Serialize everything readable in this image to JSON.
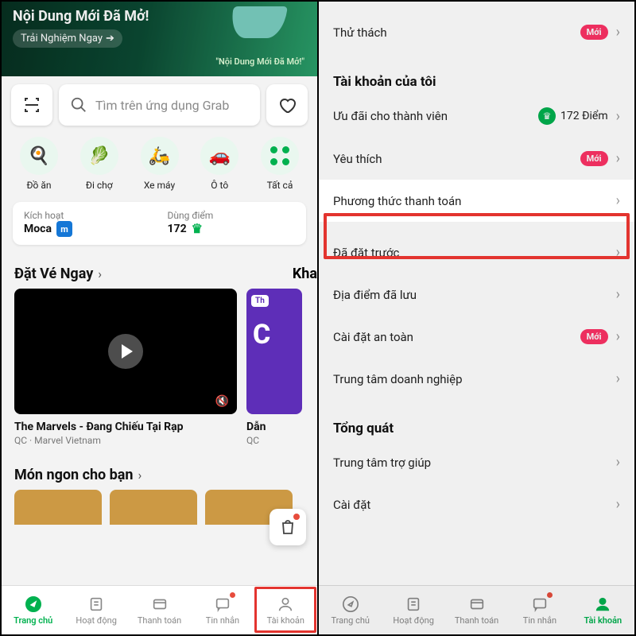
{
  "left": {
    "banner": {
      "title": "Nội Dung Mới Đã Mở!",
      "cta": "Trải Nghiệm Ngay",
      "art_caption": "\"Nội Dung Mới Đã Mở!\""
    },
    "search": {
      "placeholder": "Tìm trên ứng dụng Grab"
    },
    "categories": [
      {
        "label": "Đồ ăn"
      },
      {
        "label": "Đi chợ"
      },
      {
        "label": "Xe máy"
      },
      {
        "label": "Ô tô"
      },
      {
        "label": "Tất cả"
      }
    ],
    "wallet": {
      "activate_label": "Kích hoạt",
      "activate_value": "Moca",
      "points_label": "Dùng điểm",
      "points_value": "172"
    },
    "section_ticket": "Đặt Vé Ngay",
    "section_ticket2": "Kha",
    "ad1": {
      "title": "The Marvels - Đang Chiếu Tại Rạp",
      "sub": "QC · Marvel Vietnam"
    },
    "ad2": {
      "title": "Dẫn",
      "sub": "QC",
      "tag": "Th",
      "big": "C"
    },
    "section_food": "Món ngon cho bạn",
    "nav": [
      "Trang chủ",
      "Hoạt động",
      "Thanh toán",
      "Tin nhắn",
      "Tài khoản"
    ]
  },
  "right": {
    "rows_top": [
      {
        "label": "Thử thách",
        "new": true
      }
    ],
    "section_account": "Tài khoản của tôi",
    "rows_account": [
      {
        "label": "Ưu đãi cho thành viên",
        "points": "172 Điểm"
      },
      {
        "label": "Yêu thích",
        "new": true
      },
      {
        "label": "Phương thức thanh toán",
        "highlight": true
      },
      {
        "label": "Đã đặt trước"
      },
      {
        "label": "Địa điểm đã lưu"
      },
      {
        "label": "Cài đặt an toàn",
        "new": true
      },
      {
        "label": "Trung tâm doanh nghiệp"
      }
    ],
    "section_general": "Tổng quát",
    "rows_general": [
      {
        "label": "Trung tâm trợ giúp"
      },
      {
        "label": "Cài đặt"
      }
    ],
    "badge_new": "Mới",
    "nav": [
      "Trang chủ",
      "Hoạt động",
      "Thanh toán",
      "Tin nhắn",
      "Tài khoản"
    ]
  }
}
